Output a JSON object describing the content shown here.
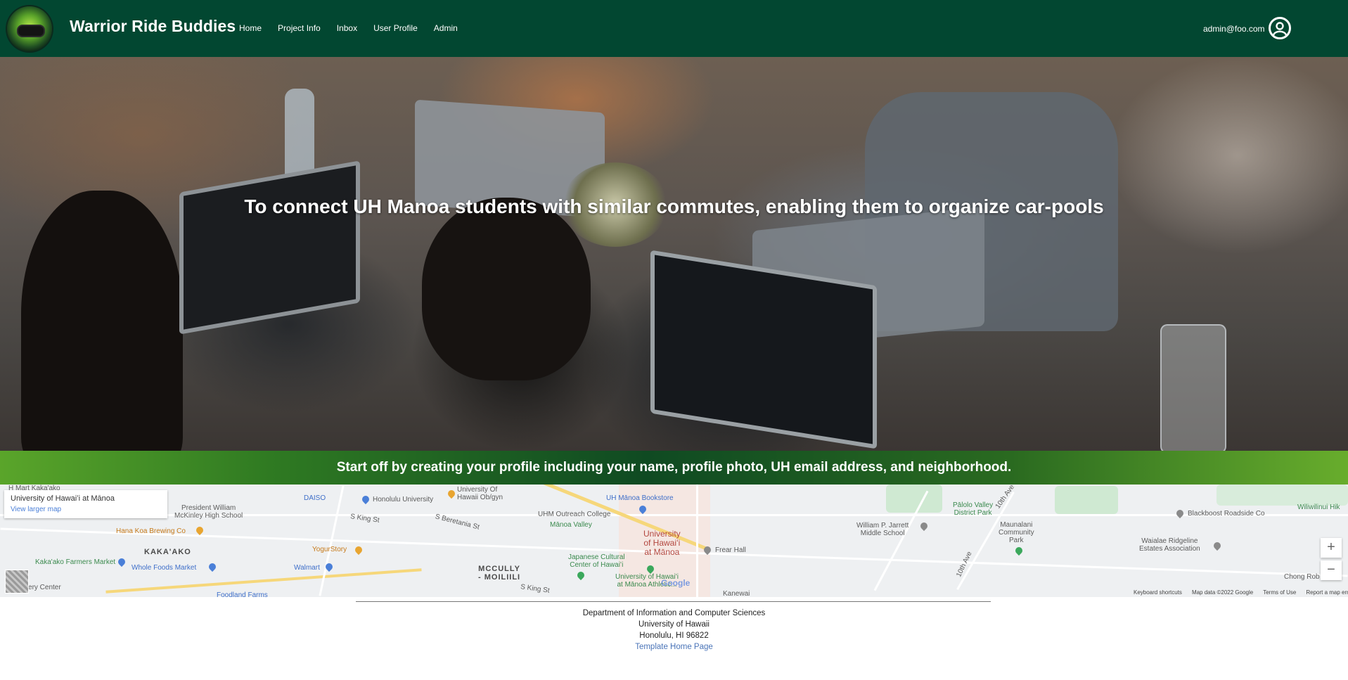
{
  "navbar": {
    "brand": "Warrior Ride Buddies",
    "links": [
      "Home",
      "Project Info",
      "Inbox",
      "User Profile",
      "Admin"
    ],
    "user_email": "admin@foo.com",
    "logo_icon": "car-steering-wheel-logo",
    "user_icon": "user-circle-icon",
    "background_color": "#024731"
  },
  "hero": {
    "title": "To connect UH Manoa students with similar commutes, enabling them to organize car-pools"
  },
  "banner": {
    "text": "Start off by creating your profile including your name, profile photo, UH email address, and neighborhood."
  },
  "map": {
    "place_card_title": "University of Hawaiʻi at Mānoa",
    "place_card_link": "View larger map",
    "zoom_in": "+",
    "zoom_out": "−",
    "google_logo": "Google",
    "footer_links": [
      "Keyboard shortcuts",
      "Map data ©2022 Google",
      "Terms of Use",
      "Report a map error"
    ],
    "labels": {
      "university_name": "University\nof Hawaiʻi\nat Mānoa",
      "mccully": "MCCULLY\n- MOILIILI",
      "kakaako": "KAKA'AKO",
      "president_mckinley": "President William\nMcKinley High School",
      "daiso": "DAISO",
      "honolulu_university": "Honolulu University",
      "uh_obgyn": "University Of\nHawaii Ob/gyn",
      "uh_bookstore": "UH Mānoa Bookstore",
      "uhm_outreach": "UHM Outreach College",
      "manoa_valley": "Mānoa Valley",
      "frear_hall": "Frear Hall",
      "hana_koa": "Hana Koa Brewing Co",
      "yogurstory": "YogurStory",
      "kakaako_market": "Kaka'ako Farmers Market",
      "whole_foods": "Whole Foods Market",
      "walmart": "Walmart",
      "japanese_cultural": "Japanese Cultural\nCenter of Hawaiʻi",
      "uh_athletic": "University of Hawaiʻi\nat Mānoa Athletic...",
      "foodland": "Foodland Farms",
      "jarrett": "William P. Jarrett\nMiddle School",
      "palolo_park": "Pālolo Valley\nDistrict Park",
      "maunalani": "Maunalani\nCommunity\nPark",
      "blackboost": "Blackboost Roadside Co",
      "waialae": "Waialae Ridgeline\nEstates Association",
      "wiliwilinui": "Wiliwilinui Hik",
      "chong_rob": "Chong Rob",
      "discovery_center": "Discovery Center",
      "h_mart": "H Mart Kaka'ako",
      "kanewai": "Kanewai",
      "s_king_st_1": "S King St",
      "s_king_st_2": "S King St",
      "s_beretania": "S Beretania St",
      "tenth_ave": "10th Ave",
      "tenth_ave_2": "10th Ave"
    }
  },
  "footer": {
    "line1": "Department of Information and Computer Sciences",
    "line2": "University of Hawaii",
    "line3": "Honolulu, HI 96822",
    "link": "Template Home Page"
  }
}
